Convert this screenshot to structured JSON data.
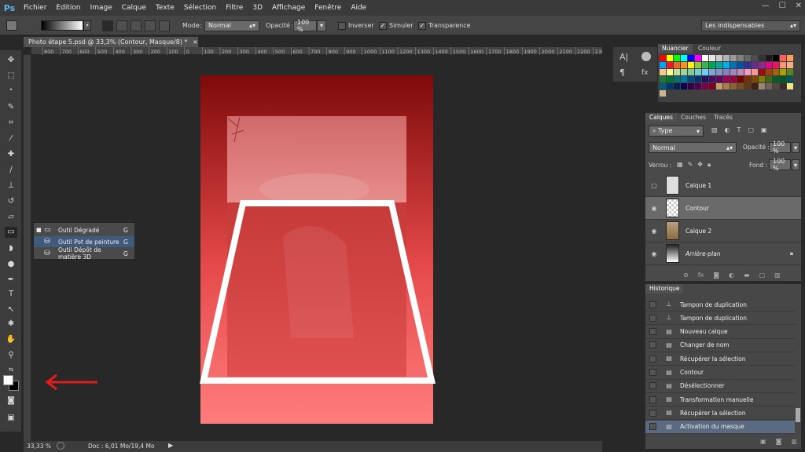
{
  "app": {
    "logo": "Ps"
  },
  "menu": [
    "Fichier",
    "Edition",
    "Image",
    "Calque",
    "Texte",
    "Sélection",
    "Filtre",
    "3D",
    "Affichage",
    "Fenêtre",
    "Aide"
  ],
  "window_controls": {
    "minimize": "—",
    "restore": "☐",
    "close": "✕"
  },
  "options": {
    "mode_label": "Mode:",
    "mode_value": "Normal",
    "opacity_label": "Opacité :",
    "opacity_value": "100 %",
    "inverser": "Inverser",
    "simuler": "Simuler",
    "transparence": "Transparence",
    "workspace": "Les indispensables"
  },
  "document": {
    "tab_title": "Photo étape 5.psd @ 33,3% (Contour, Masque/8) *",
    "ruler_ticks": [
      "800",
      "700",
      "600",
      "500",
      "400",
      "300",
      "200",
      "100",
      "0",
      "100",
      "200",
      "300",
      "400",
      "500",
      "600",
      "700",
      "800",
      "900",
      "1000",
      "1100",
      "1200",
      "1300",
      "1400",
      "1500",
      "1600",
      "1700",
      "1800",
      "1900",
      "2000",
      "2100",
      "2200",
      "2300"
    ]
  },
  "flyout": {
    "items": [
      {
        "label": "Outil Dégradé",
        "key": "G"
      },
      {
        "label": "Outil Pot de peinture",
        "key": "G"
      },
      {
        "label": "Outil Dépôt de matière 3D",
        "key": "G"
      }
    ]
  },
  "status": {
    "zoom": "33,33 %",
    "doc": "Doc : 6,01 Mo/19,4 Mo"
  },
  "swatches": {
    "tabs": [
      "Nuancier",
      "Couleur"
    ],
    "colors": [
      "#ff0000",
      "#ffff00",
      "#00ff00",
      "#00ffff",
      "#0000ff",
      "#ff00ff",
      "#ffffff",
      "#e6e6e6",
      "#cccccc",
      "#b3b3b3",
      "#999999",
      "#808080",
      "#666666",
      "#4d4d4d",
      "#333333",
      "#1a1a1a",
      "#000000",
      "#ff6060",
      "#ffa060",
      "#00a0ff",
      "#ed1c24",
      "#f26522",
      "#f7941d",
      "#fff200",
      "#8dc63f",
      "#39b54a",
      "#00a651",
      "#00a99d",
      "#00aeef",
      "#0072bc",
      "#0054a6",
      "#2e3192",
      "#662d91",
      "#92278f",
      "#ec008c",
      "#ed145b",
      "#f69679",
      "#f9ad81",
      "#fdc68a",
      "#fff799",
      "#c4df9b",
      "#a3d39c",
      "#82ca9c",
      "#7accc8",
      "#6dcff6",
      "#7da7d9",
      "#8393ca",
      "#8781bd",
      "#a186be",
      "#bd8cbf",
      "#f49ac1",
      "#f5989d",
      "#9e0b0f",
      "#a0410d",
      "#a36209",
      "#aba000",
      "#598527",
      "#1a7b30",
      "#007236",
      "#00746b",
      "#0076a3",
      "#004b80",
      "#003471",
      "#1b1464",
      "#440e62",
      "#630460",
      "#9e005d",
      "#9e0039",
      "#790000",
      "#7b2e00",
      "#7d4900",
      "#827b00",
      "#406618",
      "#005e20",
      "#005826",
      "#005952",
      "#005b7f",
      "#003663",
      "#002157",
      "#0d004c",
      "#32004b",
      "#4b0049",
      "#7b0046",
      "#7a0026",
      "#c69c6d",
      "#a67c52",
      "#8c6239",
      "#754c24",
      "#603913",
      "#3c2415",
      "#998675",
      "#736357",
      "#534741",
      "#362f2d",
      "#f0e68c",
      "#d2b48c"
    ]
  },
  "layers": {
    "tabs": [
      "Calques",
      "Couches",
      "Tracés"
    ],
    "filter": "Type",
    "blend": "Normal",
    "opacity_label": "Opacité :",
    "opacity_value": "100 %",
    "lock_label": "Verrou :",
    "fill_label": "Fond :",
    "fill_value": "100 %",
    "items": [
      {
        "name": "Calque 1",
        "visible": false,
        "selected": false,
        "thumb": "calque1"
      },
      {
        "name": "Contour",
        "visible": true,
        "selected": true,
        "thumb": "contour"
      },
      {
        "name": "Calque 2",
        "visible": true,
        "selected": false,
        "thumb": "calque2"
      },
      {
        "name": "Arrière-plan",
        "visible": true,
        "selected": false,
        "thumb": "fond"
      }
    ]
  },
  "history": {
    "title": "Historique",
    "items": [
      {
        "label": "Tampon de duplication",
        "icon": "stamp-icon"
      },
      {
        "label": "Tampon de duplication",
        "icon": "stamp-icon"
      },
      {
        "label": "Nouveau calque",
        "icon": "doc-icon"
      },
      {
        "label": "Changer de nom",
        "icon": "doc-icon"
      },
      {
        "label": "Récupérer la sélection",
        "icon": "doc-icon"
      },
      {
        "label": "Contour",
        "icon": "doc-icon"
      },
      {
        "label": "Désélectionner",
        "icon": "doc-icon"
      },
      {
        "label": "Transformation manuelle",
        "icon": "doc-icon"
      },
      {
        "label": "Récupérer la sélection",
        "icon": "doc-icon"
      },
      {
        "label": "Activation du masque",
        "icon": "doc-icon",
        "selected": true
      }
    ]
  }
}
